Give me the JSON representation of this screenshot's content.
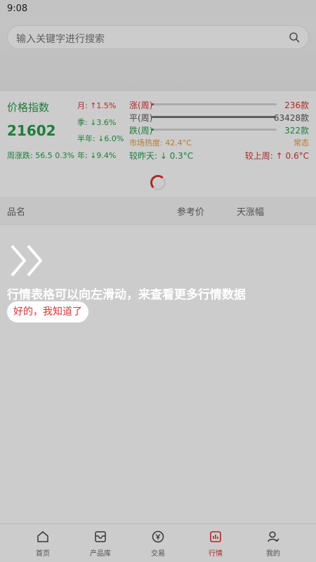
{
  "status": {
    "time": "9:08"
  },
  "search": {
    "placeholder": "输入关键字进行搜索",
    "icon": "search-icon"
  },
  "index": {
    "title": "价格指数",
    "value": "21602",
    "week_change": "周涨跌: 56.5 0.3%",
    "month": "月: ↑1.5%",
    "quarter": "季: ↓3.6%",
    "half_year": "半年: ↓6.0%",
    "year": "年: ↓9.4%",
    "rows": [
      {
        "label": "涨(周)",
        "count": "236款",
        "fraction": 0.004,
        "color": "#d93434"
      },
      {
        "label": "平(周)",
        "count": "63428款",
        "fraction": 0.99,
        "color": "#777777"
      },
      {
        "label": "跌(周)",
        "count": "322款",
        "fraction": 0.005,
        "color": "#2a9d4a"
      }
    ],
    "market_heat_label": "市场热度: 42.4°C",
    "market_heat_state": "常态",
    "vs_yesterday": "较昨天: ↓ 0.3°C",
    "vs_last_week": "较上周: ↑ 0.6°C"
  },
  "table": {
    "col_name": "品名",
    "col_ref_price": "参考价",
    "col_day_change": "天涨幅"
  },
  "guide": {
    "text": "行情表格可以向左滑动，来查看更多行情数据",
    "button": "好的，我知道了"
  },
  "tabbar": {
    "items": [
      {
        "label": "首页",
        "icon": "home-icon"
      },
      {
        "label": "产品库",
        "icon": "product-library-icon"
      },
      {
        "label": "交易",
        "icon": "trade-icon"
      },
      {
        "label": "行情",
        "icon": "market-icon",
        "active": true
      },
      {
        "label": "我的",
        "icon": "profile-icon"
      }
    ],
    "active_color": "#d93434"
  }
}
